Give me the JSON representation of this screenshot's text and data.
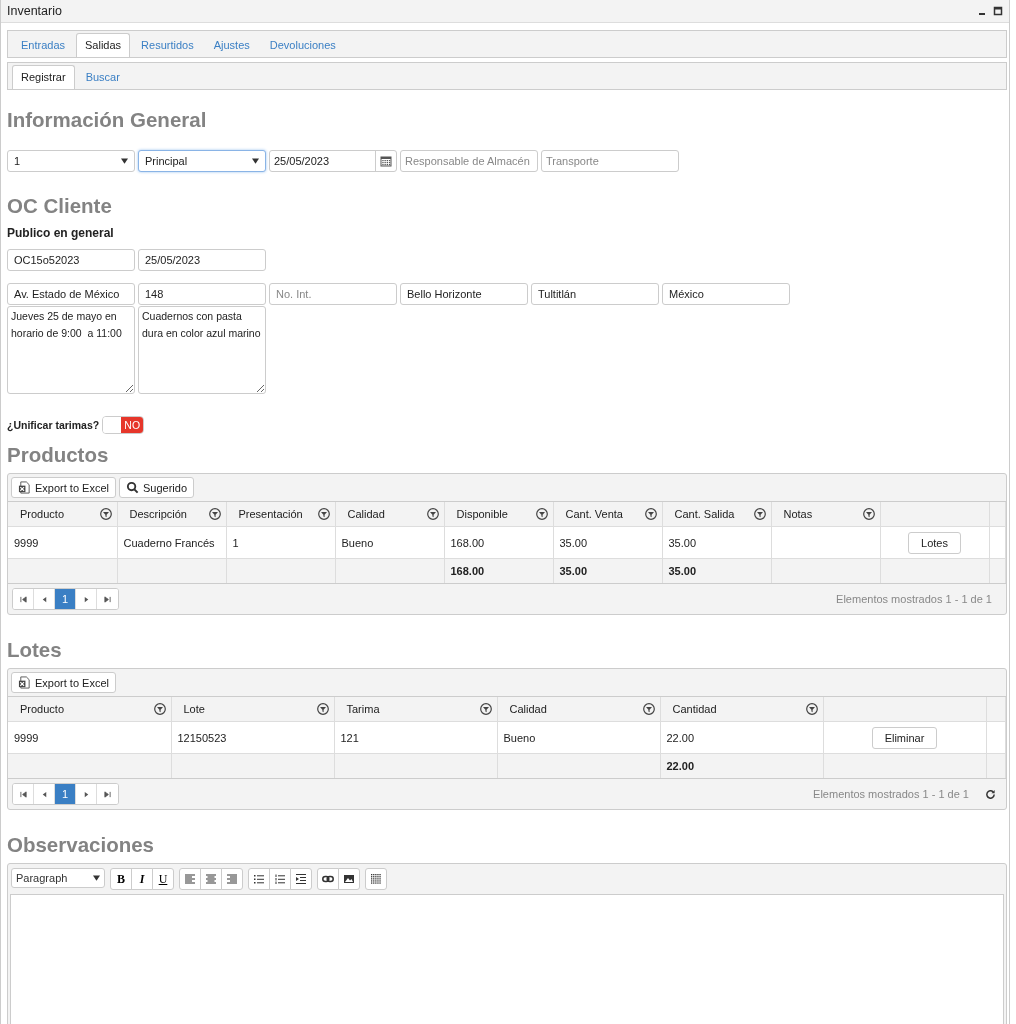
{
  "window": {
    "title": "Inventario"
  },
  "tabs": [
    {
      "label": "Entradas",
      "selected": false
    },
    {
      "label": "Salidas",
      "selected": true
    },
    {
      "label": "Resurtidos",
      "selected": false
    },
    {
      "label": "Ajustes",
      "selected": false
    },
    {
      "label": "Devoluciones",
      "selected": false
    }
  ],
  "subtabs": [
    {
      "label": "Registrar",
      "selected": true
    },
    {
      "label": "Buscar",
      "selected": false
    }
  ],
  "general": {
    "heading": "Información General",
    "fields": [
      {
        "kind": "select",
        "value": "1",
        "focused": false
      },
      {
        "kind": "select",
        "value": "Principal",
        "focused": true
      },
      {
        "kind": "date",
        "value": "25/05/2023",
        "focused": false
      },
      {
        "kind": "text",
        "placeholder": "Responsable de Almacén",
        "focused": false
      },
      {
        "kind": "text",
        "placeholder": "Transporte",
        "focused": false
      }
    ]
  },
  "oc_cliente": {
    "heading": "OC Cliente",
    "client": "Publico en general",
    "order_fields": [
      {
        "value": "OC15o52023"
      },
      {
        "value": "25/05/2023"
      }
    ],
    "address_fields": [
      {
        "value": "Av. Estado de México"
      },
      {
        "value": "148"
      },
      {
        "placeholder": "No. Int."
      },
      {
        "value": "Bello Horizonte"
      },
      {
        "value": "Tultitlán"
      },
      {
        "value": "México"
      }
    ],
    "notes": [
      "Jueves 25 de mayo en horario de 9:00  a 11:00",
      "Cuadernos con pasta dura en color azul marino"
    ]
  },
  "unify": {
    "label": "¿Unificar tarimas?",
    "on": false,
    "text": "NO"
  },
  "productos": {
    "heading": "Productos",
    "toolbar": [
      {
        "kind": "excel",
        "label": "Export to Excel"
      },
      {
        "kind": "search",
        "label": "Sugerido"
      }
    ],
    "columns": [
      {
        "label": "Producto"
      },
      {
        "label": "Descripción"
      },
      {
        "label": "Presentación"
      },
      {
        "label": "Calidad"
      },
      {
        "label": "Disponible",
        "total": "168.00"
      },
      {
        "label": "Cant. Venta",
        "total": "35.00"
      },
      {
        "label": "Cant. Salida",
        "total": "35.00"
      },
      {
        "label": "Notas"
      }
    ],
    "rows": [
      {
        "cells": [
          "9999",
          "Cuaderno Francés",
          "1",
          "Bueno",
          "168.00",
          "35.00",
          "35.00"
        ],
        "action": "Lotes"
      }
    ],
    "pager": {
      "pages": [
        {
          "label": "1",
          "selected": true
        }
      ],
      "info": "Elementos mostrados 1 - 1 de 1",
      "refresh": false
    }
  },
  "lotes": {
    "heading": "Lotes",
    "toolbar": [
      {
        "kind": "excel",
        "label": "Export to Excel"
      }
    ],
    "columns": [
      {
        "label": "Producto"
      },
      {
        "label": "Lote"
      },
      {
        "label": "Tarima"
      },
      {
        "label": "Calidad"
      },
      {
        "label": "Cantidad",
        "total": "22.00"
      }
    ],
    "rows": [
      {
        "cells": [
          "9999",
          "12150523",
          "121",
          "Bueno",
          "22.00"
        ],
        "action": "Eliminar"
      }
    ],
    "pager": {
      "pages": [
        {
          "label": "1",
          "selected": true
        }
      ],
      "info": "Elementos mostrados 1 - 1 de 1",
      "refresh": true
    }
  },
  "observaciones": {
    "heading": "Observaciones",
    "format": "Paragraph",
    "text_buttons": [
      "B",
      "I",
      "U"
    ]
  }
}
